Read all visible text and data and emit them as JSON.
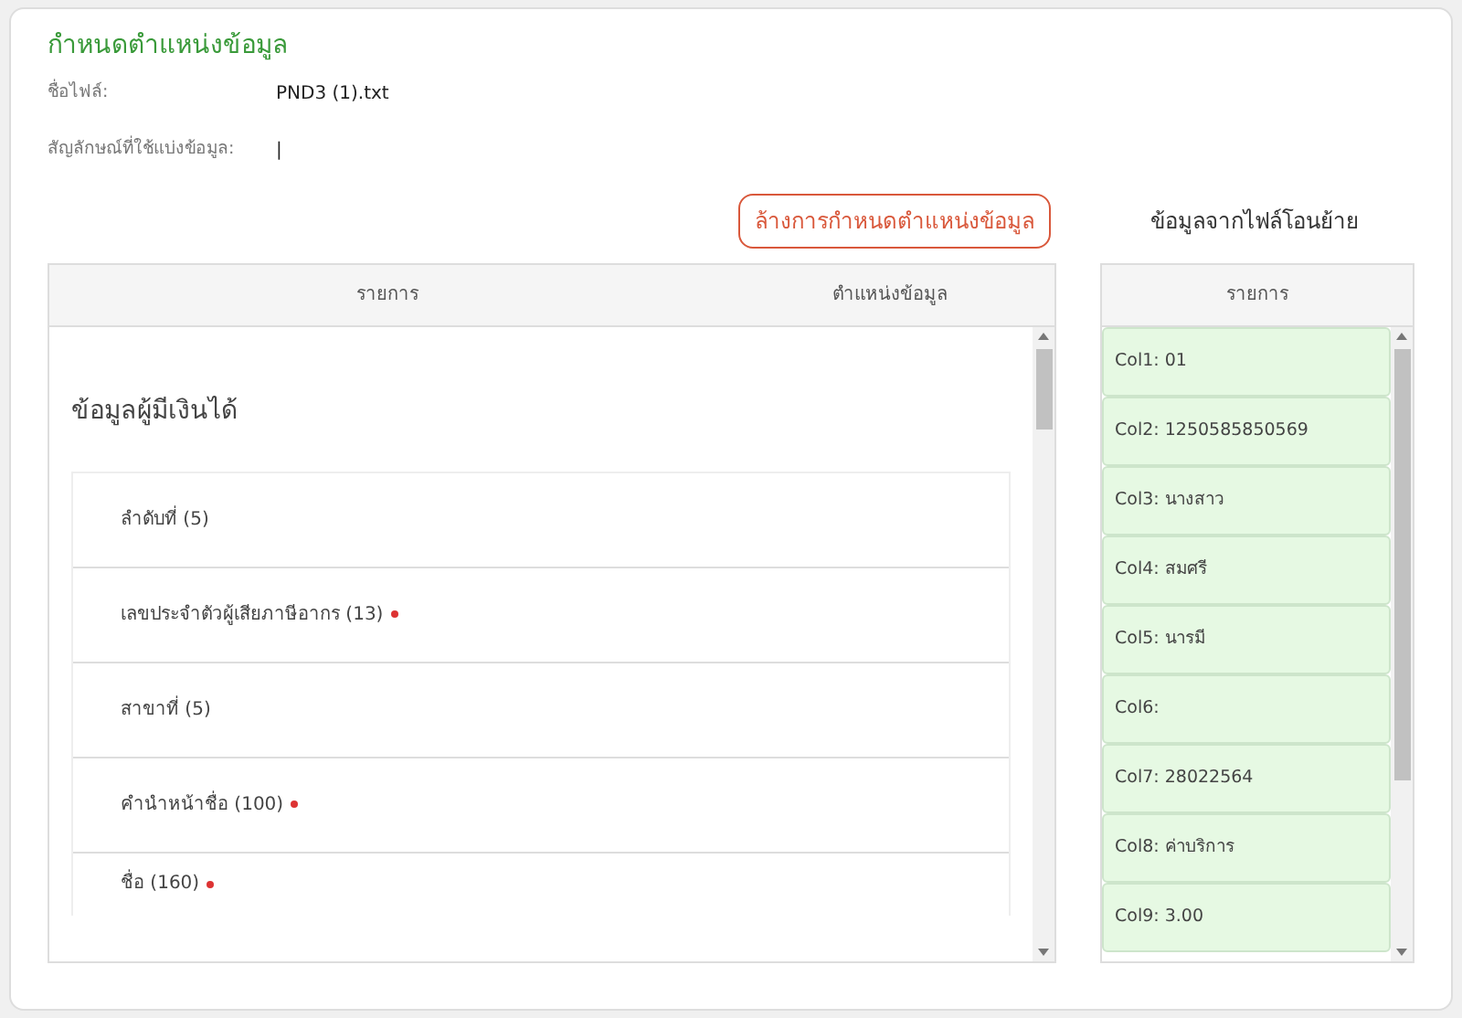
{
  "title": "กำหนดตำแหน่งข้อมูล",
  "fields": [
    {
      "label": "ชื่อไฟล์:",
      "value": "PND3 (1).txt"
    },
    {
      "label": "สัญลักษณ์ที่ใช้แบ่งข้อมูล:",
      "value": "|"
    }
  ],
  "clear_button": "ล้างการกำหนดตำแหน่งข้อมูล",
  "mapping_table": {
    "columns": [
      "รายการ",
      "ตำแหน่งข้อมูล"
    ],
    "section": "ข้อมูลผู้มีเงินได้",
    "rows": [
      {
        "label": "ลำดับที่ (5)",
        "required": false
      },
      {
        "label": "เลขประจำตัวผู้เสียภาษีอากร (13)",
        "required": true
      },
      {
        "label": "สาขาที่ (5)",
        "required": false
      },
      {
        "label": "คำนำหน้าชื่อ (100)",
        "required": true
      },
      {
        "label": "ชื่อ (160)",
        "required": true
      }
    ]
  },
  "file_panel": {
    "title": "ข้อมูลจากไฟล์โอนย้าย",
    "column": "รายการ",
    "items": [
      "Col1: 01",
      "Col2: 1250585850569",
      "Col3: นางสาว",
      "Col4: สมศรี",
      "Col5: นารมี",
      "Col6:",
      "Col7: 28022564",
      "Col8: ค่าบริการ",
      "Col9: 3.00"
    ]
  }
}
